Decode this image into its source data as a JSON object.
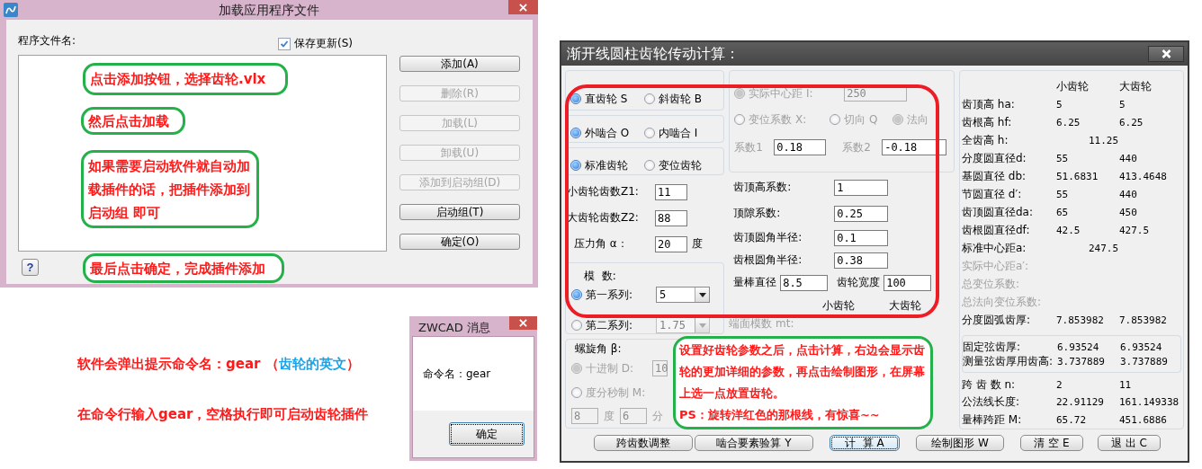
{
  "load_dialog": {
    "title": "加载应用程序文件",
    "file_list_label": "程序文件名:",
    "save_updates": {
      "label": "保存更新(S)",
      "checked": true
    },
    "buttons": [
      {
        "label": "添加(A)",
        "disabled": false
      },
      {
        "label": "删除(R)",
        "disabled": true
      },
      {
        "label": "加载(L)",
        "disabled": true
      },
      {
        "label": "卸载(U)",
        "disabled": true
      },
      {
        "label": "添加到启动组(D)",
        "disabled": true
      },
      {
        "label": "启动组(T)",
        "disabled": false
      },
      {
        "label": "确定(O)",
        "disabled": false
      }
    ],
    "help": "?"
  },
  "load_callouts": [
    {
      "text": "点击添加按钮，选择齿轮.vlx"
    },
    {
      "text": "然后点击加载"
    },
    {
      "text": "如果需要启动软件就自动加载插件的话，把插件添加到启动组 即可"
    },
    {
      "text": "最后点击确定，完成插件添加"
    }
  ],
  "notes": [
    {
      "segments": [
        {
          "text": "软件会弹出提示命令名：gear （",
          "color": "#ff1a1a"
        },
        {
          "text": "齿轮的英文",
          "color": "#1aa3e8"
        },
        {
          "text": "）",
          "color": "#ff1a1a"
        }
      ]
    },
    {
      "segments": [
        {
          "text": "在命令行输入gear，空格执行即可启动齿轮插件",
          "color": "#ff1a1a"
        }
      ]
    }
  ],
  "message_box": {
    "title": "ZWCAD 消息",
    "message": "命令名：gear",
    "ok_button": "确定"
  },
  "gear_dialog": {
    "title": "渐开线圆柱齿轮传动计算：",
    "radio_groups": [
      [
        {
          "label": "直齿轮 S",
          "selected": true
        },
        {
          "label": "斜齿轮 B",
          "selected": false
        }
      ],
      [
        {
          "label": "外啮合 O",
          "selected": true
        },
        {
          "label": "内啮合 I",
          "selected": false
        }
      ],
      [
        {
          "label": "标准齿轮",
          "selected": true
        },
        {
          "label": "变位齿轮",
          "selected": false
        }
      ]
    ],
    "teeth_fields": [
      {
        "label": "小齿轮齿数Z1:",
        "value": "11"
      },
      {
        "label": "大齿轮齿数Z2:",
        "value": "88"
      },
      {
        "label": "压力角 α：",
        "value": "20",
        "unit": "度"
      }
    ],
    "module": {
      "title": "模  数:",
      "options": [
        {
          "label": "第一系列:",
          "value": "5",
          "selected": true,
          "disabled": false
        },
        {
          "label": "第二系列:",
          "value": "1.75",
          "selected": false,
          "disabled": true
        }
      ]
    },
    "helix": {
      "title": "螺旋角 β:",
      "disabled": true,
      "options": [
        {
          "label": "十进制 D:",
          "value": "10",
          "selected": true
        },
        {
          "label": "度分秒制 M:",
          "selected": false
        }
      ],
      "dms": [
        {
          "value": "8",
          "unit": "度"
        },
        {
          "value": "6",
          "unit": "分"
        }
      ]
    },
    "center": {
      "label": "实际中心距 I:",
      "value": "250",
      "selected": true,
      "disabled": true
    },
    "shift_options": [
      {
        "label": "变位系数 X:",
        "selected": false
      },
      {
        "label": "切向 Q",
        "selected": false
      },
      {
        "label": "法向",
        "selected": true
      }
    ],
    "shift_disabled": true,
    "coefficients": [
      {
        "label": "系数1",
        "value": "0.18"
      },
      {
        "label": "系数2",
        "value": "-0.18"
      }
    ],
    "params": [
      {
        "label": "齿顶高系数:",
        "value": "1"
      },
      {
        "label": "顶隙系数:",
        "value": "0.25"
      },
      {
        "label": "齿顶圆角半径:",
        "value": "0.1"
      },
      {
        "label": "齿根圆角半径:",
        "value": "0.38"
      }
    ],
    "rod": [
      {
        "label": "量棒直径",
        "value": "8.5"
      },
      {
        "label": "齿轮宽度",
        "value": "100"
      }
    ],
    "mid_headers": [
      "小齿轮",
      "大齿轮"
    ],
    "transverse_module_label": "端面模数 mt:",
    "result_headers": [
      "小齿轮",
      "大齿轮"
    ],
    "results": [
      {
        "label": "齿顶高 ha:",
        "values": [
          "5",
          "5"
        ],
        "disabled": false
      },
      {
        "label": "齿根高 hf:",
        "values": [
          "6.25",
          "6.25"
        ],
        "disabled": false
      },
      {
        "label": "全齿高 h:",
        "values": [
          "11.25"
        ],
        "disabled": false
      },
      {
        "label": "分度圆直径d:",
        "values": [
          "55",
          "440"
        ],
        "disabled": false
      },
      {
        "label": "基圆直径 db:",
        "values": [
          "51.6831",
          "413.4648"
        ],
        "disabled": false
      },
      {
        "label": "节圆直径 d′:",
        "values": [
          "55",
          "440"
        ],
        "disabled": false
      },
      {
        "label": "齿顶圆直径da:",
        "values": [
          "65",
          "450"
        ],
        "disabled": false
      },
      {
        "label": "齿根圆直径df:",
        "values": [
          "42.5",
          "427.5"
        ],
        "disabled": false
      },
      {
        "label": "标准中心距a:",
        "values": [
          "247.5"
        ],
        "disabled": false
      },
      {
        "label": "实际中心距a′:",
        "disabled": true
      },
      {
        "label": "总变位系数:",
        "disabled": true
      },
      {
        "label": "总法向变位系数:",
        "disabled": true
      },
      {
        "label": "分度圆弧齿厚:",
        "values": [
          "7.853982",
          "7.853982"
        ],
        "disabled": false
      }
    ],
    "chord_results": [
      {
        "label": "固定弦齿厚:",
        "values": [
          "6.93524",
          "6.93524"
        ]
      },
      {
        "label": "测量弦齿厚用齿高:",
        "values": [
          "3.737889",
          "3.737889"
        ]
      }
    ],
    "span_results": [
      {
        "label": "跨 齿 数 n:",
        "values": [
          "2",
          "11"
        ]
      },
      {
        "label": "公法线长度:",
        "values": [
          "22.91129",
          "161.149338"
        ]
      },
      {
        "label": "量棒跨距 M:",
        "values": [
          "65.72",
          "451.6886"
        ]
      }
    ],
    "buttons": [
      {
        "label": "跨齿数调整",
        "focused": false
      },
      {
        "label": "啮合要素验算 Y",
        "focused": false
      },
      {
        "label": "计  算 A",
        "focused": true
      },
      {
        "label": "绘制图形 W",
        "focused": false
      },
      {
        "label": "清 空 E",
        "focused": false
      },
      {
        "label": "退 出 C",
        "focused": false
      }
    ]
  },
  "gear_callout": {
    "paragraphs": [
      "设置好齿轮参数之后，点击计算，右边会显示齿轮的更加详细的参数，再点击绘制图形，在屏幕上选一点放置齿轮。",
      "PS：旋转洋红色的那根线，有惊喜~~"
    ]
  }
}
